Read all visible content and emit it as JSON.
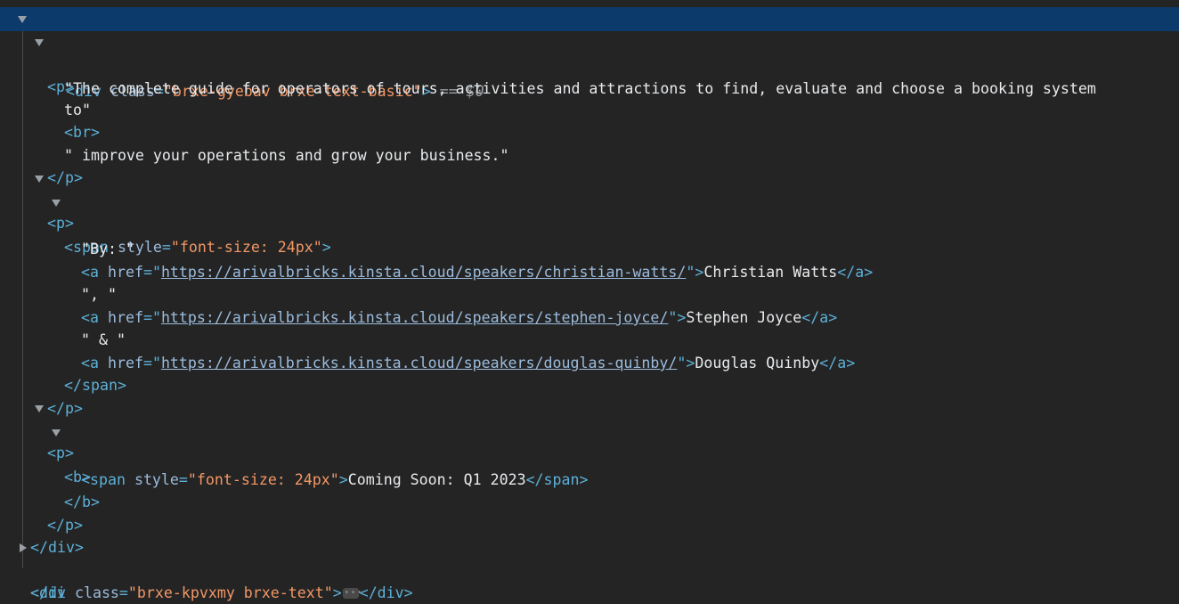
{
  "selected_element": {
    "tag_open": "<div",
    "attr_name": "class",
    "attr_value": "\"brxe-gyebav brxe-text-basic\"",
    "tag_close": ">",
    "eq": " == ",
    "dollar": "$0"
  },
  "tags": {
    "p_open": "<p>",
    "p_close": "</p>",
    "br": "<br>",
    "span_open": "<span",
    "span_close": "</span>",
    "a_open": "<a",
    "a_close": "</a>",
    "b_open": "<b>",
    "b_close": "</b>",
    "div_close": "</div>",
    "gt": ">",
    "eq_quote": "=\""
  },
  "attrs": {
    "style": "style",
    "href": "href",
    "class": "class"
  },
  "values": {
    "font_size_24": "\"font-size: 24px\"",
    "quote_close": "\""
  },
  "paragraph1": {
    "text_line1": "\"The complete guide for operators of tours, activities and attractions to find, evaluate and choose a booking system",
    "text_line2": "to\"",
    "text_line3": "\" improve your operations and grow your business.\""
  },
  "paragraph2": {
    "by": "\"By: \"",
    "sep1": "\", \"",
    "sep2": "\" & \"",
    "links": [
      {
        "href": "https://arivalbricks.kinsta.cloud/speakers/christian-watts/",
        "text": "Christian Watts"
      },
      {
        "href": "https://arivalbricks.kinsta.cloud/speakers/stephen-joyce/",
        "text": "Stephen Joyce"
      },
      {
        "href": "https://arivalbricks.kinsta.cloud/speakers/douglas-quinby/",
        "text": "Douglas Quinby"
      }
    ]
  },
  "paragraph3": {
    "text": "Coming Soon: Q1 2023"
  },
  "next_element": {
    "tag_open": "<div",
    "attr_name": "class",
    "attr_value": "\"brxe-kpvxmy brxe-text\"",
    "tag_close": ">",
    "end": "</div>",
    "partial_below": "</di"
  }
}
